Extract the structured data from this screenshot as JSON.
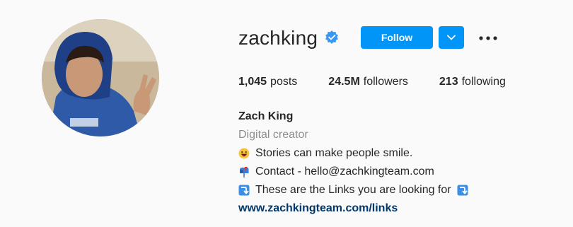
{
  "profile": {
    "username": "zachking",
    "verified": true,
    "follow_label": "Follow",
    "stats": [
      {
        "count": "1,045",
        "label": "posts"
      },
      {
        "count": "24.5M",
        "label": "followers"
      },
      {
        "count": "213",
        "label": "following"
      }
    ],
    "full_name": "Zach King",
    "category": "Digital creator",
    "bio_lines": [
      {
        "icon": "smiley-emoji-icon",
        "text": "Stories can make people smile."
      },
      {
        "icon": "mailbox-emoji-icon",
        "text": "Contact - hello@zachkingteam.com"
      },
      {
        "icon": "arrow-emoji-icon",
        "text": "These are the Links you are looking for"
      }
    ],
    "website": "www.zachkingteam.com/links"
  },
  "colors": {
    "accent": "#0095f6",
    "link": "#00376b",
    "muted": "#8e8e8e",
    "background": "#fafafa"
  }
}
